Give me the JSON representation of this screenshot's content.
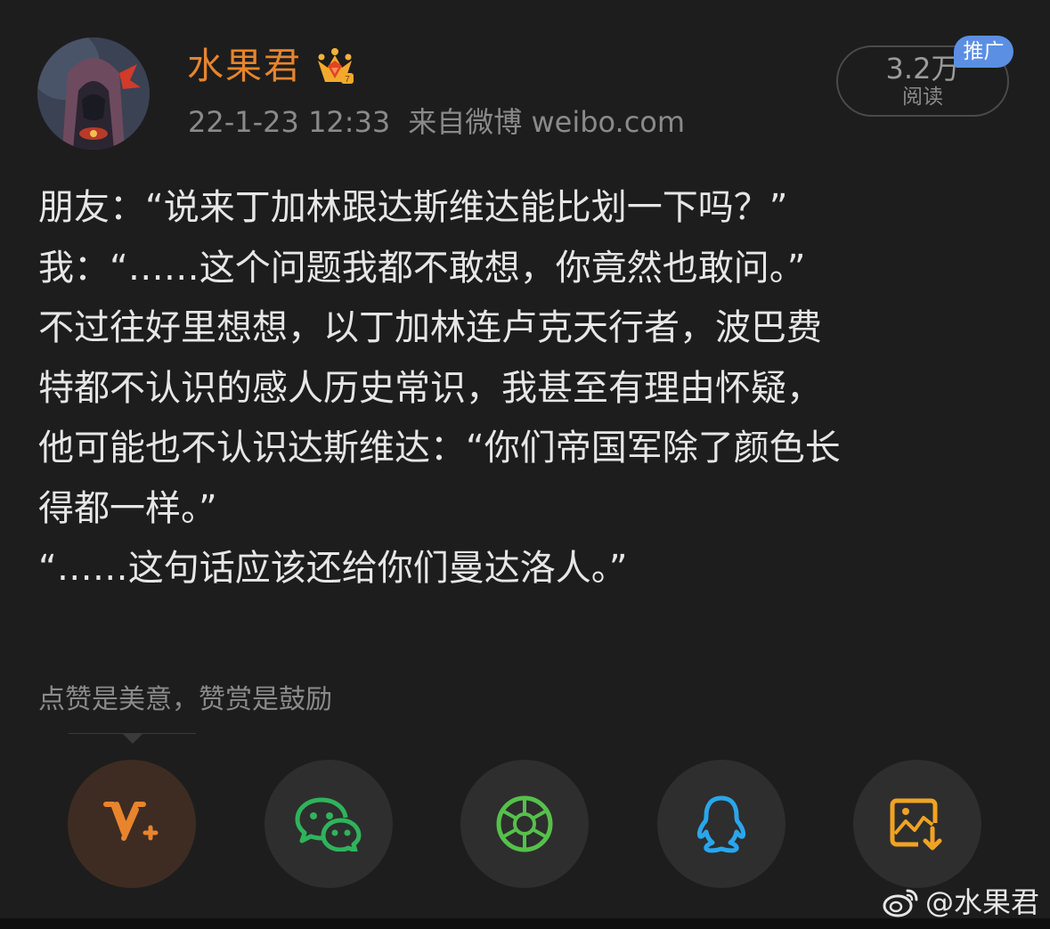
{
  "post": {
    "author": "水果君",
    "author_badge_icon": "crown-vip-icon",
    "date": "22-1-23 12:33",
    "source": "来自微博 weibo.com",
    "read_count": "3.2万",
    "read_label": "阅读",
    "promo_badge": "推广",
    "lines": [
      "朋友：“说来丁加林跟达斯维达能比划一下吗？”",
      "我：“……这个问题我都不敢想，你竟然也敢问。”",
      "不过往好里想想，以丁加林连卢克天行者，波巴费",
      "特都不认识的感人历史常识，我甚至有理由怀疑，",
      "他可能也不认识达斯维达：“你们帝国军除了颜色长",
      "得都一样。”",
      "“……这句话应该还给你们曼达洛人。”"
    ],
    "reward_prompt": "点赞是美意，赞赏是鼓励"
  },
  "actions": [
    {
      "name": "reward-button",
      "icon": "v-plus-icon"
    },
    {
      "name": "wechat-share-button",
      "icon": "wechat-icon"
    },
    {
      "name": "moments-share-button",
      "icon": "moments-aperture-icon"
    },
    {
      "name": "qq-share-button",
      "icon": "qq-penguin-icon"
    },
    {
      "name": "save-image-button",
      "icon": "image-download-icon"
    }
  ],
  "watermark": {
    "icon": "weibo-logo-icon",
    "text": "@水果君"
  },
  "colors": {
    "background": "#1d1d1d",
    "author": "#e8842c",
    "promo_badge": "#5b8fe4",
    "wechat": "#2fb35c",
    "moments": "#55c14a",
    "qq": "#2aa6ec",
    "save": "#f0a323",
    "reward": "#e8842c"
  }
}
